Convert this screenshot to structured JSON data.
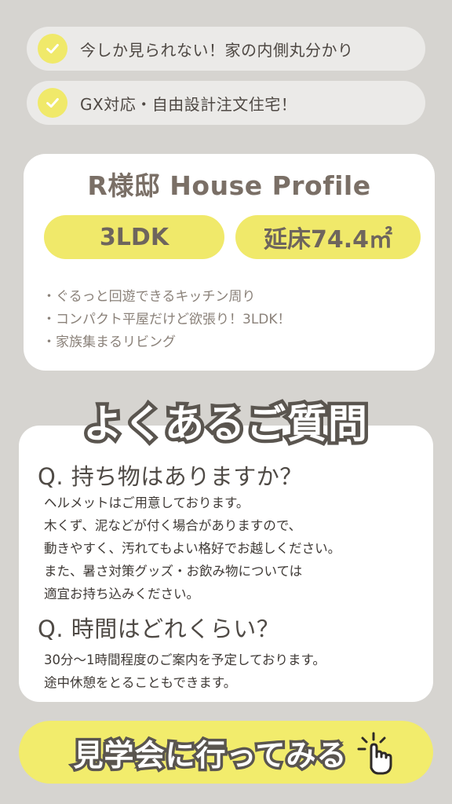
{
  "checklist": [
    {
      "text": "今しか見られない！家の内側丸分かり",
      "icon": "check-icon"
    },
    {
      "text": "GX対応・自由設計注文住宅！",
      "icon": "check-icon"
    }
  ],
  "profile": {
    "title": "R様邸 House Profile",
    "layout": "3LDK",
    "area_label": "延床74.4㎡",
    "features": [
      "・ぐるっと回遊できるキッチン周り",
      "・コンパクト平屋だけど欲張り！3LDK！",
      "・家族集まるリビング"
    ]
  },
  "faq": {
    "heading": "よくあるご質問",
    "items": [
      {
        "question": "Q. 持ち物はありますか？",
        "answer_lines": [
          "ヘルメットはご用意しております。",
          "木くず、泥などが付く場合がありますので、",
          "動きやすく、汚れてもよい格好でお越しください。",
          "また、暑さ対策グッズ・お飲み物については",
          "適宜お持ち込みください。"
        ]
      },
      {
        "question": "Q. 時間はどれくらい？",
        "answer_lines": [
          "30分～1時間程度のご案内を予定しております。",
          "途中休憩をとることもできます。"
        ]
      }
    ]
  },
  "cta": {
    "label": "見学会に行ってみる",
    "icon": "pointing-hand-click-icon"
  },
  "colors": {
    "background": "#d6d4d0",
    "accent_yellow": "#f0e96a",
    "text_dark": "#5a554f"
  }
}
